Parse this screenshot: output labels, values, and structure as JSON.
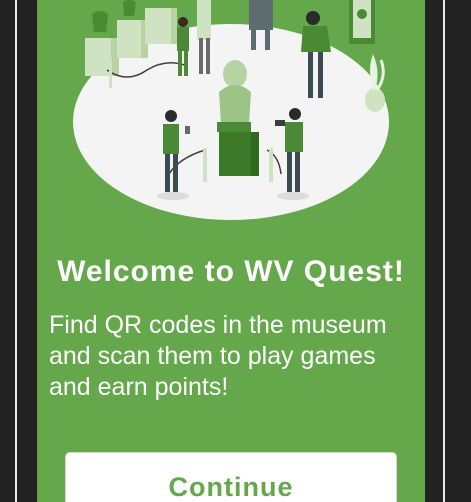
{
  "welcome": {
    "title": "Welcome to WV Quest!",
    "description": "Find QR codes in the museum and scan them to play games and earn points!",
    "continue_label": "Continue"
  },
  "colors": {
    "brand_green": "#65a74b",
    "background": "#222222",
    "text": "#ffffff"
  },
  "illustration": {
    "icon": "museum-visitors-illustration"
  }
}
